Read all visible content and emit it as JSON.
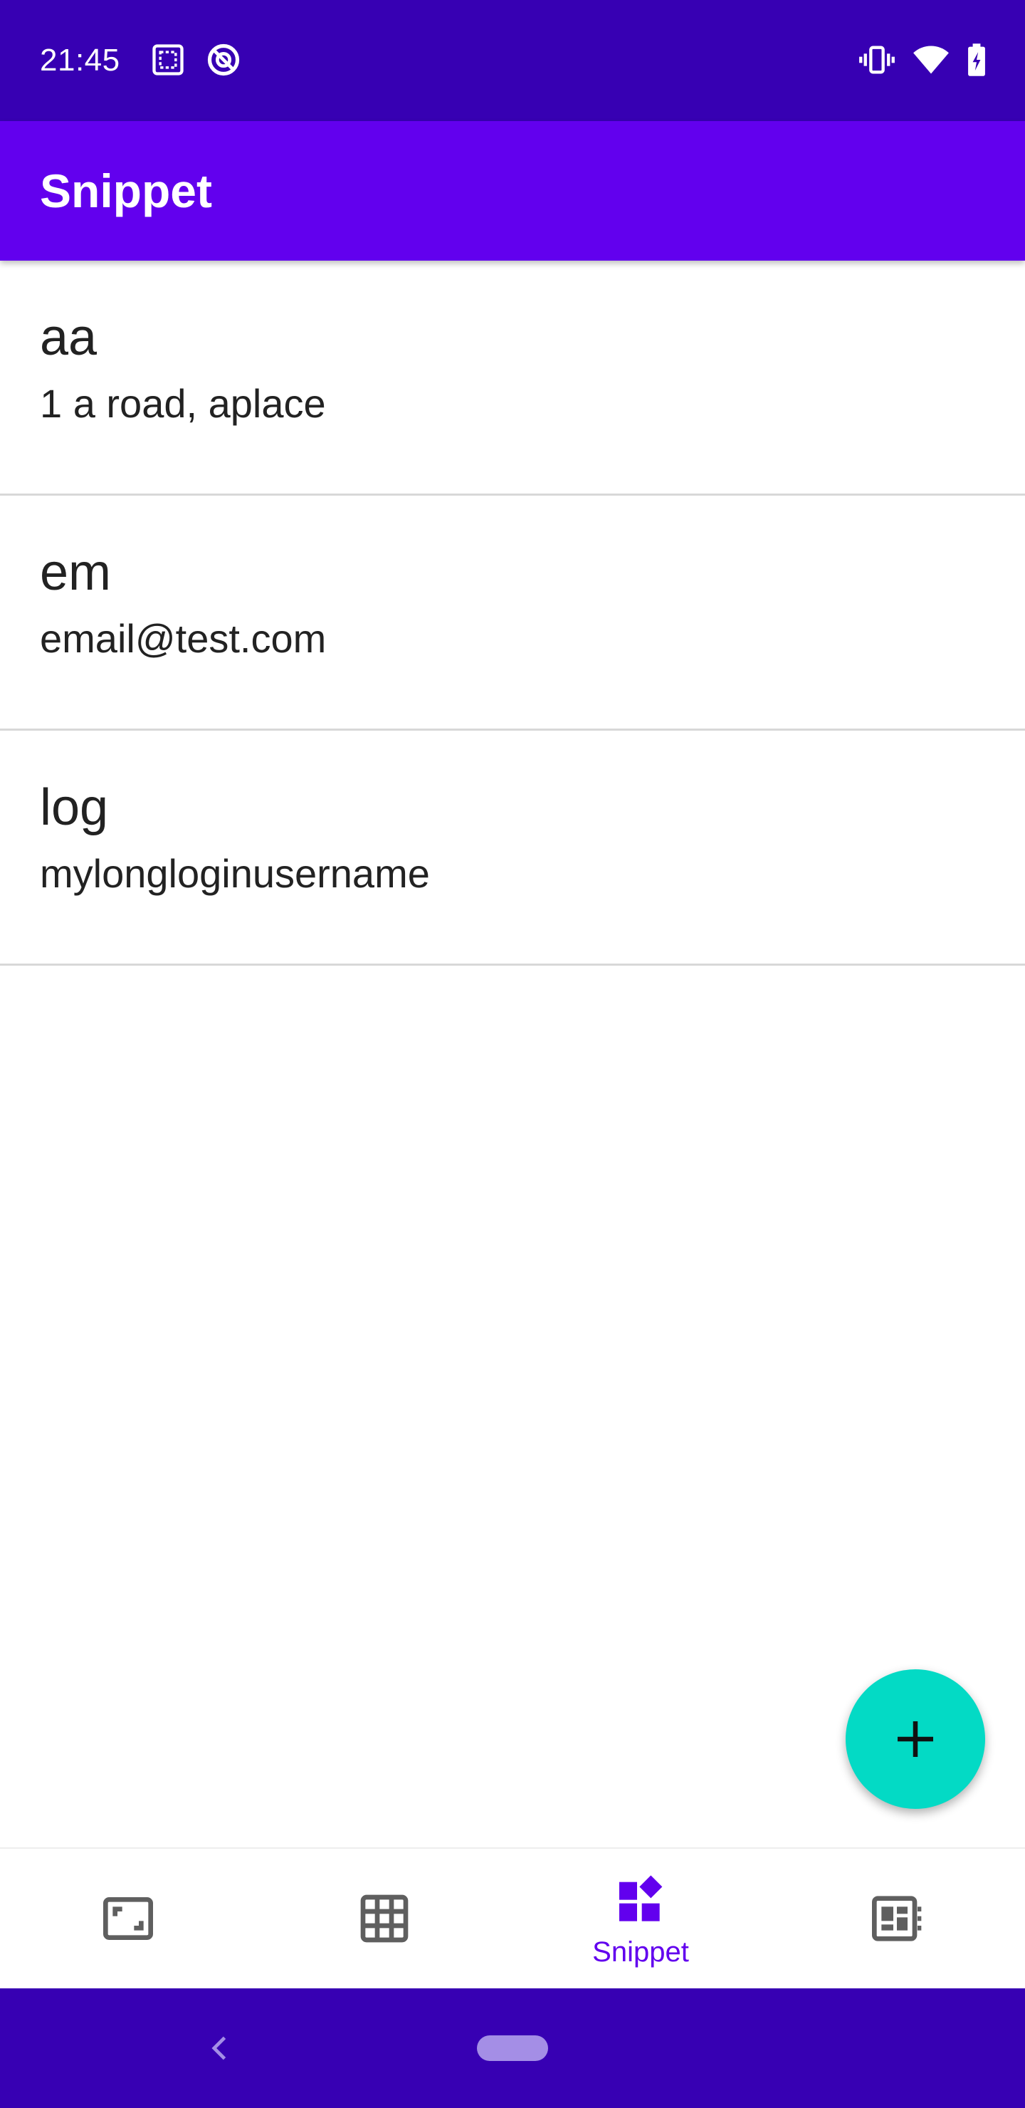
{
  "status_bar": {
    "time": "21:45",
    "left_icons": [
      "screenshot-icon",
      "data-saver-icon"
    ],
    "right_icons": [
      "vibrate-icon",
      "wifi-icon",
      "battery-charging-icon"
    ]
  },
  "app_bar": {
    "title": "Snippet"
  },
  "snippets": [
    {
      "key": "aa",
      "value": "1 a road, aplace"
    },
    {
      "key": "em",
      "value": "email@test.com"
    },
    {
      "key": "log",
      "value": "mylongloginusername"
    }
  ],
  "fab": {
    "icon": "plus-icon"
  },
  "bottom_nav": {
    "items": [
      {
        "icon": "fullscreen-frame-icon",
        "label": "",
        "selected": false
      },
      {
        "icon": "grid-icon",
        "label": "",
        "selected": false
      },
      {
        "icon": "widgets-icon",
        "label": "Snippet",
        "selected": true
      },
      {
        "icon": "dashboard-icon",
        "label": "",
        "selected": false
      }
    ]
  },
  "system_nav": {
    "icons": [
      "back-icon",
      "home-pill-icon"
    ]
  },
  "colors": {
    "status_bar": "#3700b3",
    "app_bar": "#6200ee",
    "fab": "#03dac5",
    "nav_selected": "#6200ee",
    "nav_unselected": "#5f5f5f"
  }
}
